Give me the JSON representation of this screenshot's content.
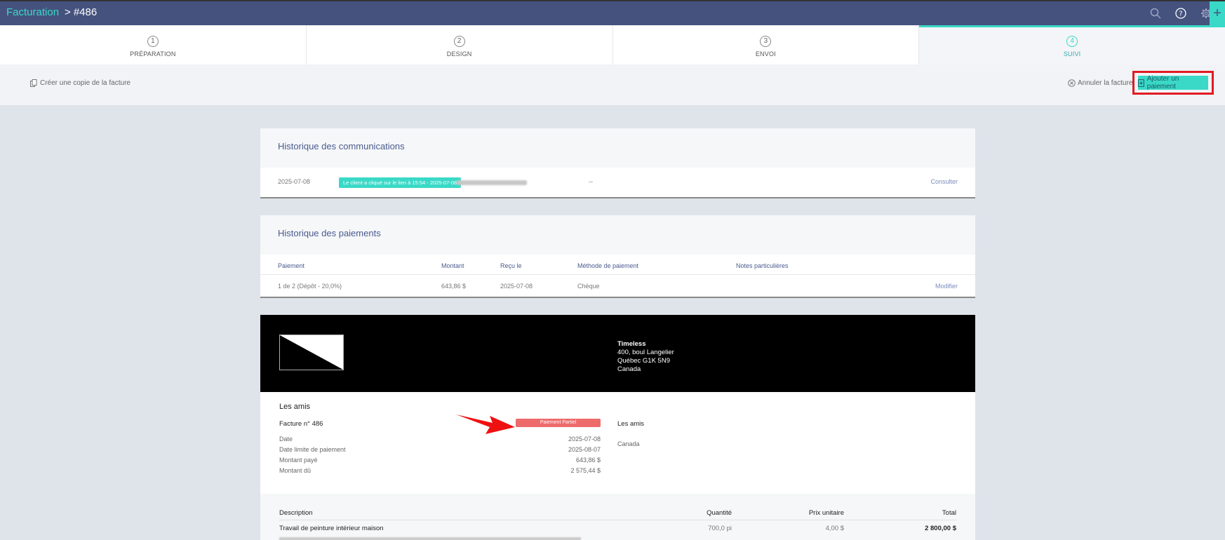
{
  "header": {
    "breadcrumb_root": "Facturation",
    "breadcrumb_separator": ">",
    "breadcrumb_current": "#486",
    "icons": [
      "search-icon",
      "help-icon",
      "gear-icon",
      "plus-icon"
    ],
    "plus_label": "+"
  },
  "steps": [
    {
      "number": "1",
      "label": "PRÉPARATION"
    },
    {
      "number": "2",
      "label": "DESIGN"
    },
    {
      "number": "3",
      "label": "ENVOI"
    },
    {
      "number": "4",
      "label": "SUIVI",
      "active": true
    }
  ],
  "actions": {
    "copy_label": "Créer une copie de la facture",
    "cancel_label": "Annuler la facture",
    "add_payment_label": "Ajouter un paiement"
  },
  "communications": {
    "title": "Historique des communications",
    "row": {
      "date": "2025-07-08",
      "badge": "Le client a cliqué sur le lien à 15:54 - 2025-07-08",
      "dash": "--",
      "action": "Consulter"
    }
  },
  "payments": {
    "title": "Historique des paiements",
    "columns": [
      "Paiement",
      "Montant",
      "Reçu le",
      "Méthode de paiement",
      "Notes particulières"
    ],
    "row": {
      "payment": "1 de 2 (Dépôt - 20,0%)",
      "amount": "643,86 $",
      "received": "2025-07-08",
      "method": "Chèque",
      "notes": "",
      "action": "Modifier"
    }
  },
  "invoice": {
    "company": {
      "name": "Timeless",
      "address1": "400, boul Langelier",
      "address2": "Québec G1K 5N9",
      "country": "Canada"
    },
    "client_title": "Les amis",
    "number_label": "Facture n° 486",
    "status": "Paiement Partiel",
    "client_name": "Les amis",
    "client_country": "Canada",
    "meta": [
      {
        "label": "Date",
        "value": "2025-07-08"
      },
      {
        "label": "Date limite de paiement",
        "value": "2025-08-07"
      },
      {
        "label": "Montant payé",
        "value": "643,86 $"
      },
      {
        "label": "Montant dû",
        "value": "2 575,44 $"
      }
    ],
    "items_header": {
      "description": "Description",
      "quantity": "Quantité",
      "unit_price": "Prix unitaire",
      "total": "Total"
    },
    "items": [
      {
        "description": "Travail de peinture intérieur maison",
        "quantity": "700,0 pi",
        "unit_price": "4,00 $",
        "total": "2 800,00 $"
      }
    ]
  },
  "colors": {
    "accent": "#3ad9c7",
    "header": "#45527e",
    "highlight": "#e11b22",
    "status": "#ee6b6b"
  }
}
